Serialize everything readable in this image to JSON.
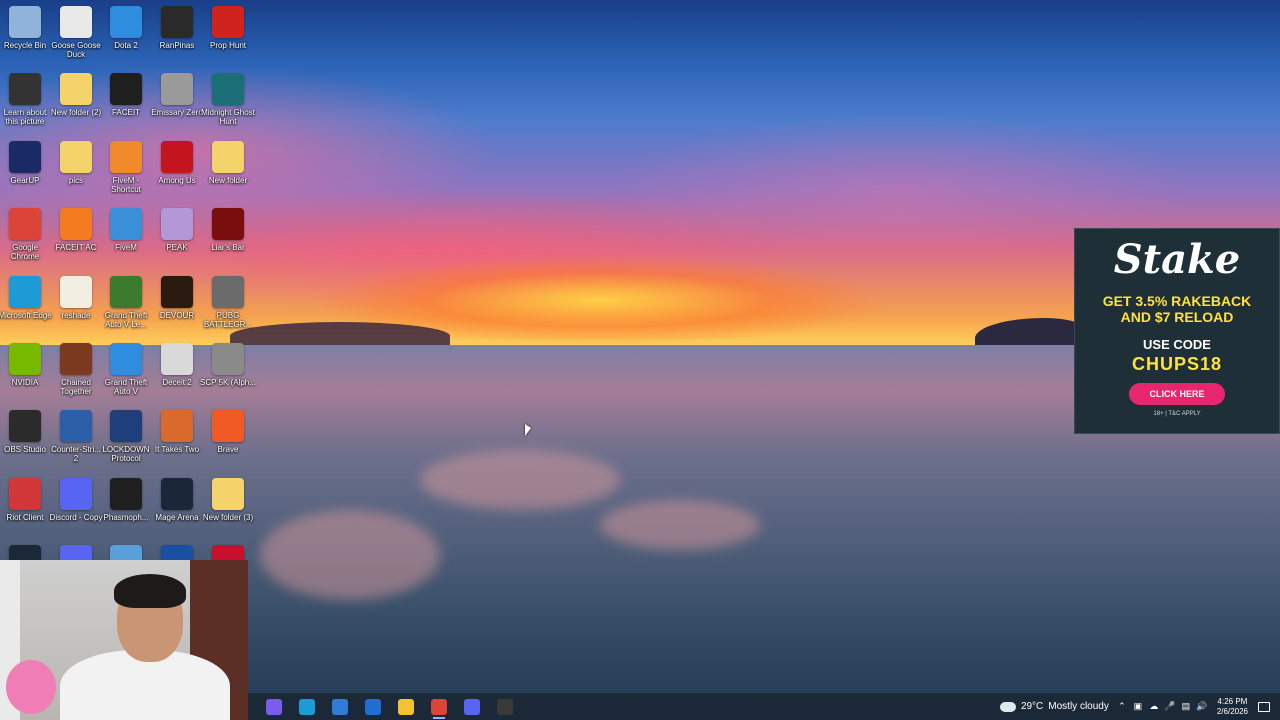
{
  "desktop_icons": [
    {
      "label": "Recycle Bin",
      "icon": "recycle-bin-icon",
      "color": "#8fb3d9"
    },
    {
      "label": "Goose Goose Duck",
      "icon": "goose-icon",
      "color": "#e9e9e9"
    },
    {
      "label": "Dota 2",
      "icon": "ie-icon",
      "color": "#2f8de0"
    },
    {
      "label": "RanPinas",
      "icon": "ranpinas-icon",
      "color": "#2a2a2a"
    },
    {
      "label": "Prop Hunt",
      "icon": "prop-hunt-icon",
      "color": "#d0231e"
    },
    {
      "label": "Learn about this picture",
      "icon": "camera-icon",
      "color": "#333"
    },
    {
      "label": "New folder (2)",
      "icon": "folder-icon",
      "color": "#f4d36b"
    },
    {
      "label": "FACEIT",
      "icon": "faceit-icon",
      "color": "#1f1f1f"
    },
    {
      "label": "Emissary Zero",
      "icon": "emissary-zero-icon",
      "color": "#9a9a9a"
    },
    {
      "label": "Midnight Ghost Hunt",
      "icon": "ghost-hunt-icon",
      "color": "#1c6f77"
    },
    {
      "label": "GearUP",
      "icon": "gearup-icon",
      "color": "#1a2a66"
    },
    {
      "label": "pics",
      "icon": "folder-icon",
      "color": "#f4d36b"
    },
    {
      "label": "FiveM - Shortcut",
      "icon": "fivem-icon",
      "color": "#f08a2a"
    },
    {
      "label": "Among Us",
      "icon": "among-us-icon",
      "color": "#c4141d"
    },
    {
      "label": "New folder",
      "icon": "folder-icon",
      "color": "#f4d36b"
    },
    {
      "label": "Google Chrome",
      "icon": "chrome-icon",
      "color": "#db4437"
    },
    {
      "label": "FACEIT AC",
      "icon": "faceit-ac-icon",
      "color": "#f47b20"
    },
    {
      "label": "FiveM",
      "icon": "fivem-app-icon",
      "color": "#3a8fd9"
    },
    {
      "label": "PEAK",
      "icon": "peak-icon",
      "color": "#b497d6"
    },
    {
      "label": "Liar's Bar",
      "icon": "liars-bar-icon",
      "color": "#7a0d0d"
    },
    {
      "label": "Microsoft Edge",
      "icon": "edge-icon",
      "color": "#1d9bd7"
    },
    {
      "label": "reshade",
      "icon": "file-icon",
      "color": "#f2eee2"
    },
    {
      "label": "Grand Theft Auto V Le...",
      "icon": "gta-v-icon",
      "color": "#3c7a2e"
    },
    {
      "label": "DEVOUR",
      "icon": "devour-icon",
      "color": "#2b1a10"
    },
    {
      "label": "PUBG BATTLEGR...",
      "icon": "pubg-icon",
      "color": "#6b6b6b"
    },
    {
      "label": "NVIDIA",
      "icon": "nvidia-icon",
      "color": "#76b900"
    },
    {
      "label": "Chained Together",
      "icon": "chained-together-icon",
      "color": "#7c3a20"
    },
    {
      "label": "Grand Theft Auto V",
      "icon": "ie-icon",
      "color": "#2f8de0"
    },
    {
      "label": "Deceit 2",
      "icon": "deceit-icon",
      "color": "#d9d9d9"
    },
    {
      "label": "SCP 5K (Alph...",
      "icon": "scp-icon",
      "color": "#8a8a8a"
    },
    {
      "label": "OBS Studio",
      "icon": "obs-icon",
      "color": "#2b2b2b"
    },
    {
      "label": "Counter-Stri... 2",
      "icon": "cs2-icon",
      "color": "#2b5fa8"
    },
    {
      "label": "LOCKDOWN Protocol",
      "icon": "lockdown-icon",
      "color": "#1f3e7c"
    },
    {
      "label": "It Takes Two",
      "icon": "it-takes-two-icon",
      "color": "#d96a2b"
    },
    {
      "label": "Brave",
      "icon": "brave-icon",
      "color": "#f15a24"
    },
    {
      "label": "Riot Client",
      "icon": "riot-icon",
      "color": "#d13639"
    },
    {
      "label": "Discord - Copy",
      "icon": "discord-icon",
      "color": "#5865f2"
    },
    {
      "label": "Phasmoph...",
      "icon": "phasmophobia-icon",
      "color": "#1f1f1f"
    },
    {
      "label": "Mage Arena",
      "icon": "mage-arena-icon",
      "color": "#1b2638"
    },
    {
      "label": "New folder (3)",
      "icon": "folder-icon",
      "color": "#f4d36b"
    },
    {
      "label": "",
      "icon": "steam-icon",
      "color": "#1b2838"
    },
    {
      "label": "",
      "icon": "discord-icon",
      "color": "#5865f2"
    },
    {
      "label": "",
      "icon": "game-icon",
      "color": "#5aa0d8"
    },
    {
      "label": "",
      "icon": "bet-icon",
      "color": "#1a4fa3"
    },
    {
      "label": "",
      "icon": "app-icon",
      "color": "#c8102e"
    }
  ],
  "ad": {
    "brand": "Stake",
    "line1": "GET 3.5% RAKEBACK",
    "line2": "AND $7 RELOAD",
    "code_label": "USE CODE",
    "code": "CHUPS18",
    "cta": "CLICK HERE",
    "fine_print": "18+ | T&C APPLY"
  },
  "taskbar": {
    "apps": [
      {
        "icon": "copilot-icon",
        "color": "#7b5cf0"
      },
      {
        "icon": "edge-icon",
        "color": "#1d9bd7"
      },
      {
        "icon": "store-icon",
        "color": "#2f7bd6"
      },
      {
        "icon": "mail-icon",
        "color": "#1f6fd1"
      },
      {
        "icon": "file-explorer-icon",
        "color": "#f2c230"
      },
      {
        "icon": "chrome-icon",
        "color": "#db4437"
      },
      {
        "icon": "discord-icon",
        "color": "#5865f2"
      },
      {
        "icon": "obs-icon",
        "color": "#3a3a3a"
      }
    ],
    "weather_temp": "29°C",
    "weather_text": "Mostly cloudy",
    "time": "4:26 PM",
    "date": "2/6/2026"
  }
}
